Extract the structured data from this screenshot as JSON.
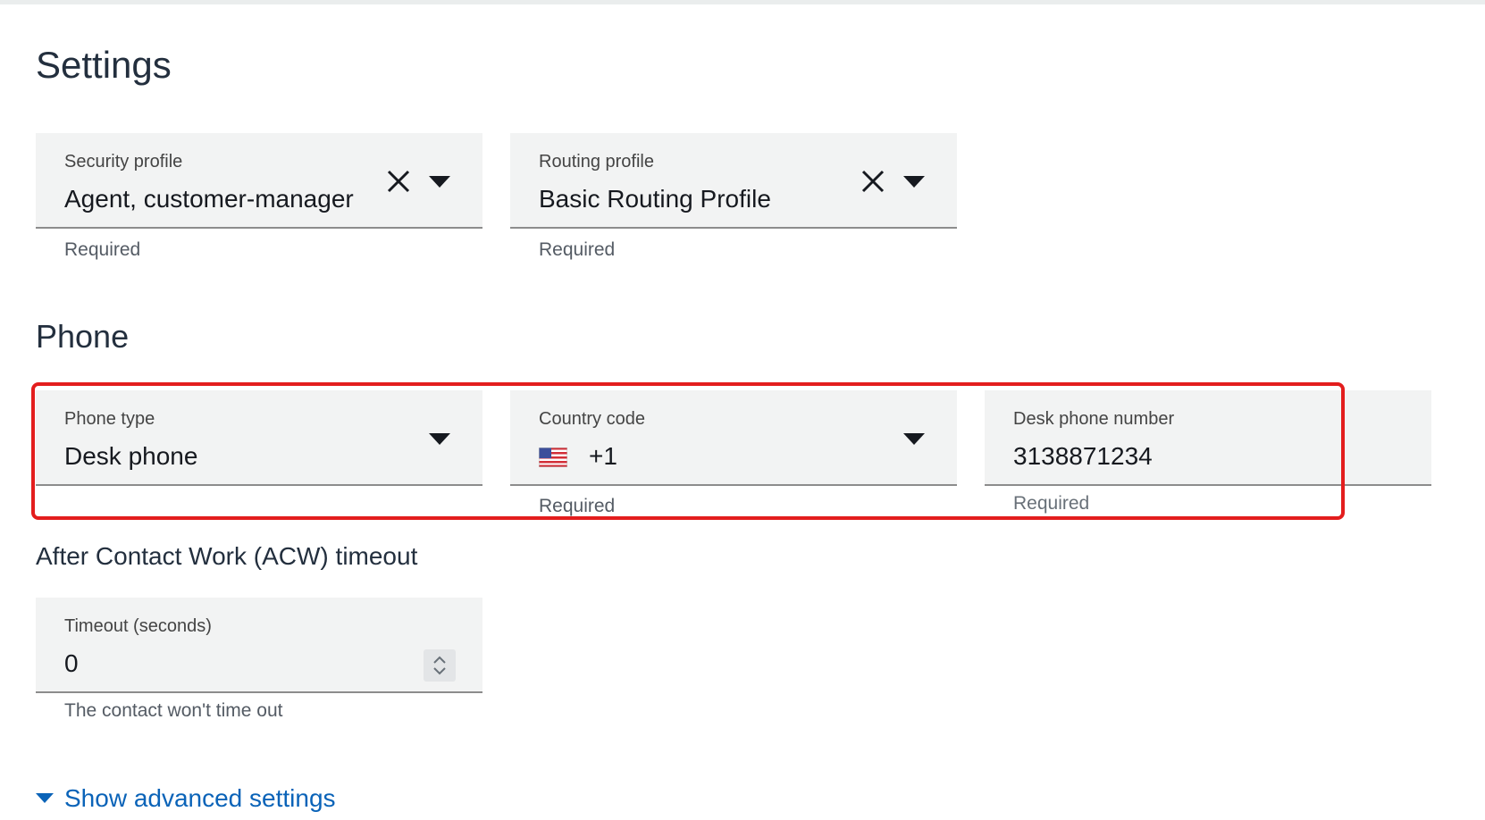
{
  "page": {
    "title": "Settings"
  },
  "settings": {
    "security_profile": {
      "label": "Security profile",
      "value": "Agent, customer-manager",
      "hint": "Required"
    },
    "routing_profile": {
      "label": "Routing profile",
      "value": "Basic Routing Profile",
      "hint": "Required"
    }
  },
  "phone": {
    "section_title": "Phone",
    "phone_type": {
      "label": "Phone type",
      "value": "Desk phone"
    },
    "country_code": {
      "label": "Country code",
      "value": "+1",
      "hint": "Required",
      "flag_icon": "us-flag-icon"
    },
    "desk_phone_number": {
      "label": "Desk phone number",
      "value": "3138871234",
      "hint": "Required"
    }
  },
  "acw": {
    "title": "After Contact Work (ACW) timeout",
    "timeout": {
      "label": "Timeout (seconds)",
      "value": "0",
      "hint": "The contact won't time out"
    }
  },
  "advanced": {
    "label": "Show advanced settings"
  },
  "colors": {
    "highlight": "#e31d1d",
    "link": "#0a63b8",
    "field_background": "#f2f3f3"
  }
}
